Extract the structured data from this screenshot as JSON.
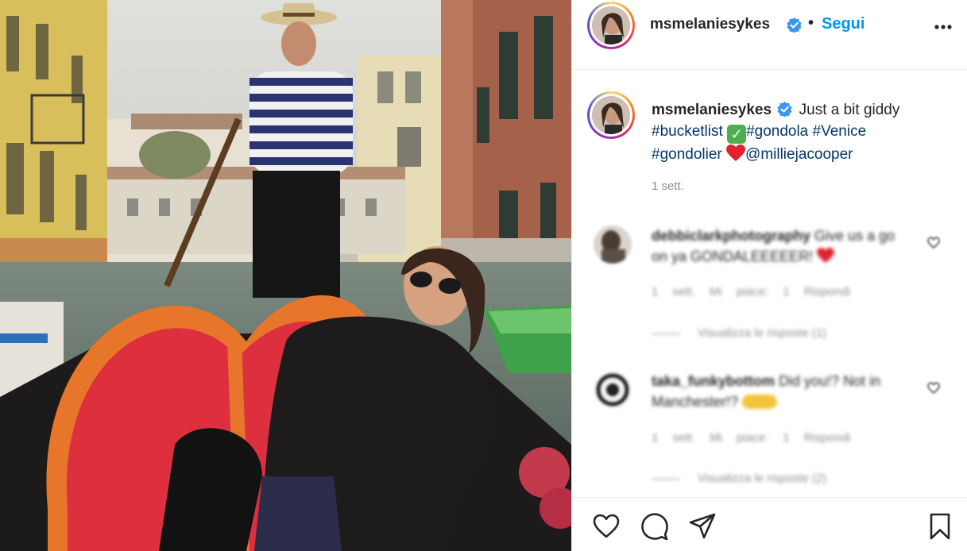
{
  "post": {
    "username": "msmelaniesykes",
    "follow_label": "Segui",
    "separator": "•"
  },
  "caption": {
    "username": "msmelaniesykes",
    "text_intro": "Just a bit giddy",
    "tag_bucketlist": "#bucketlist",
    "tag_gondola": "#gondola",
    "tag_venice": "#Venice",
    "tag_gondolier": "#gondolier",
    "mention": "@milliejacooper",
    "time": "1 sett."
  },
  "comments": [
    {
      "username": "debbiclarkphotography",
      "text": "Give us a go on ya GONDALEEEEER!",
      "time": "1 sett.",
      "likes": "Mi piace: 1",
      "reply": "Rispondi",
      "view_replies": "Visualizza le risposte (1)"
    },
    {
      "username": "taka_funkybottom",
      "text": "Did you!? Not in Manchester!?",
      "time": "1 sett.",
      "likes": "Mi piace: 1",
      "reply": "Rispondi",
      "view_replies": "Visualizza le risposte (2)"
    }
  ],
  "icons": {
    "verified": "verified-badge-icon",
    "more": "more-options-icon",
    "like": "heart-icon",
    "comment": "comment-bubble-icon",
    "share": "paper-plane-icon",
    "save": "bookmark-icon"
  },
  "colors": {
    "link_blue": "#0095f6",
    "hashtag": "#00376b",
    "verified": "#3897f0",
    "muted": "#8e8e8e"
  }
}
